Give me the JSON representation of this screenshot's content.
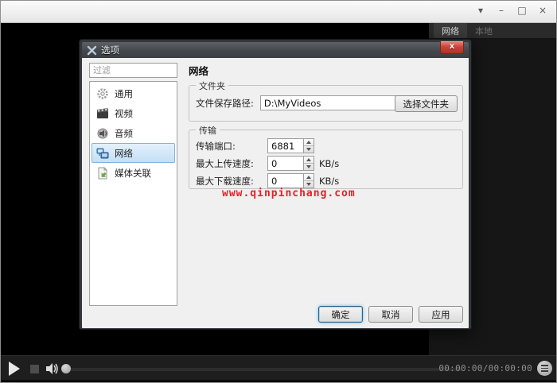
{
  "window_controls": {
    "menu_glyph": "▾",
    "minimize_glyph": "–",
    "maximize_glyph": "□",
    "close_glyph": "×"
  },
  "playlist_panel": {
    "tabs": [
      {
        "label": "网络"
      },
      {
        "label": "本地"
      }
    ]
  },
  "player_bar": {
    "time": "00:00:00/00:00:00"
  },
  "dialog": {
    "title": "选项",
    "close_glyph": "x",
    "filter_placeholder": "过滤",
    "sidebar_items": [
      {
        "label": "通用",
        "icon": "gear-icon"
      },
      {
        "label": "视频",
        "icon": "film-icon"
      },
      {
        "label": "音频",
        "icon": "speaker-icon"
      },
      {
        "label": "网络",
        "icon": "network-icon",
        "selected": true
      },
      {
        "label": "媒体关联",
        "icon": "media-file-icon"
      }
    ],
    "page_title": "网络",
    "folder_group": {
      "legend": "文件夹",
      "path_label": "文件保存路径:",
      "path_value": "D:\\MyVideos",
      "choose_button": "选择文件夹"
    },
    "transfer_group": {
      "legend": "传输",
      "rows": [
        {
          "label": "传输端口:",
          "value": "6881",
          "unit": ""
        },
        {
          "label": "最大上传速度:",
          "value": "0",
          "unit": "KB/s"
        },
        {
          "label": "最大下载速度:",
          "value": "0",
          "unit": "KB/s"
        }
      ]
    },
    "watermark": "www.qinpinchang.com",
    "buttons": {
      "ok": "确定",
      "cancel": "取消",
      "apply": "应用"
    }
  },
  "colors": {
    "selection_blue": "#c4dff5",
    "close_button_red": "#cf4339",
    "watermark_red": "#ee1c25"
  }
}
